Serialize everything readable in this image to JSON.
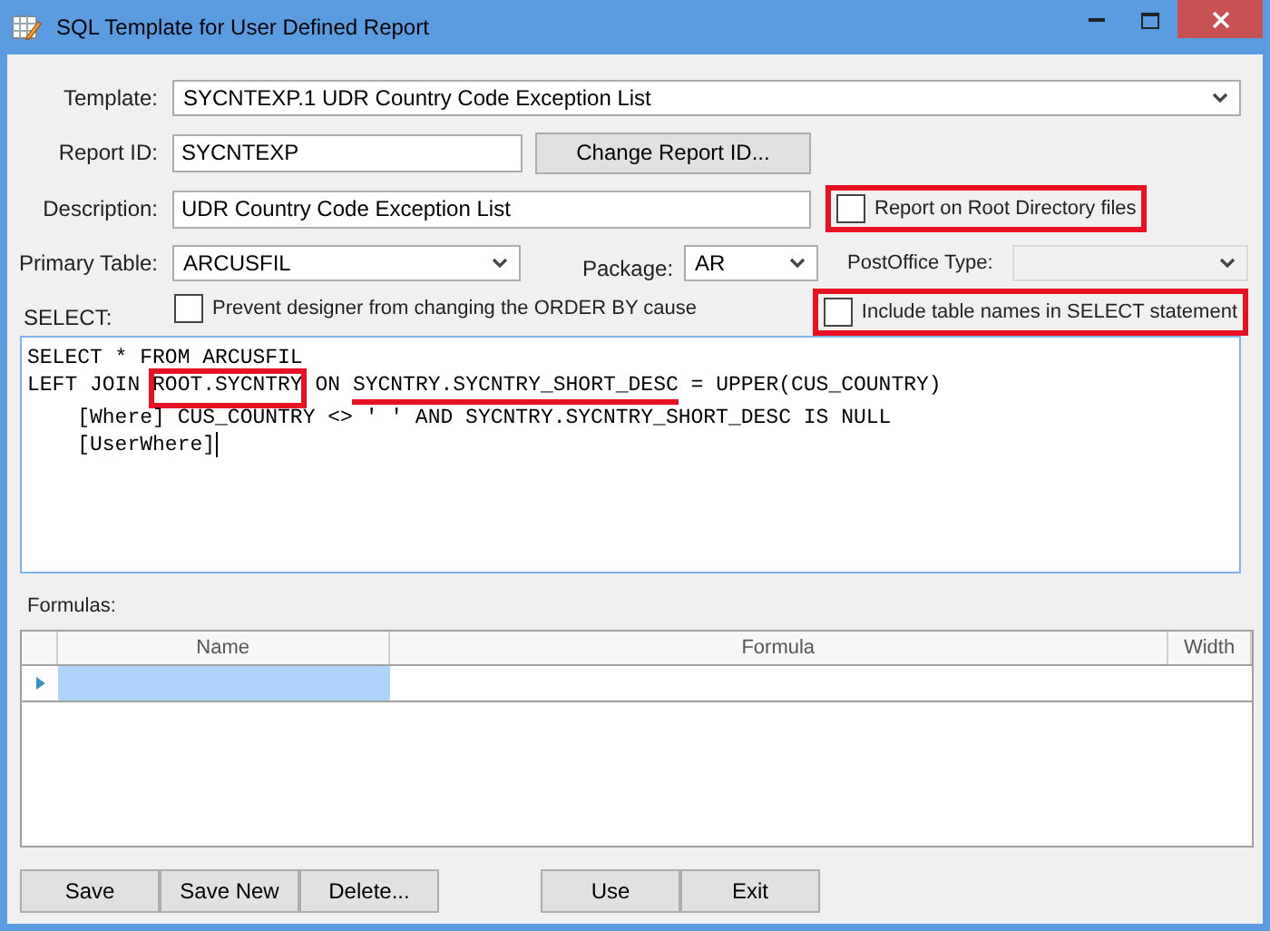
{
  "window": {
    "title": "SQL Template for User Defined Report"
  },
  "template": {
    "label": "Template:",
    "value": "SYCNTEXP.1  UDR Country Code Exception List"
  },
  "report_id": {
    "label": "Report ID:",
    "value": "SYCNTEXP",
    "button": "Change Report ID..."
  },
  "description": {
    "label": "Description:",
    "value": "UDR Country Code Exception List"
  },
  "root_directory": {
    "label": "Report on Root Directory files",
    "checked": false,
    "highlighted": true
  },
  "primary_table": {
    "label": "Primary Table:",
    "value": "ARCUSFIL"
  },
  "package": {
    "label": "Package:",
    "value": "AR"
  },
  "postoffice_type": {
    "label": "PostOffice Type:",
    "disabled": true
  },
  "select_label": "SELECT:",
  "prevent_order_by": {
    "label": "Prevent designer from changing the ORDER BY cause",
    "checked": false
  },
  "include_table_names": {
    "label": "Include table names in SELECT statement",
    "checked": false,
    "highlighted": true
  },
  "sql": [
    [
      {
        "text": "SELECT * FROM ARCUSFIL"
      }
    ],
    [
      {
        "text": "LEFT JOIN "
      },
      {
        "text": "ROOT.SYCNTRY",
        "boxed": true
      },
      {
        "text": " ON "
      },
      {
        "text": "SYCNTRY.SYCNTRY_SHORT_DESC",
        "underlined": true
      },
      {
        "text": " = UPPER(CUS_COUNTRY)"
      }
    ],
    [
      {
        "text": "    [Where] CUS_COUNTRY <> ' ' AND SYCNTRY.SYCNTRY_SHORT_DESC IS NULL"
      }
    ],
    [
      {
        "text": "    [UserWhere]"
      }
    ]
  ],
  "formulas": {
    "label": "Formulas:",
    "columns": [
      "Name",
      "Formula",
      "Width"
    ],
    "rows": [
      {
        "selected": true
      }
    ]
  },
  "edit_buttons": [
    "Save",
    "Save New",
    "Delete..."
  ],
  "dialog_buttons": [
    "Use",
    "Exit"
  ]
}
